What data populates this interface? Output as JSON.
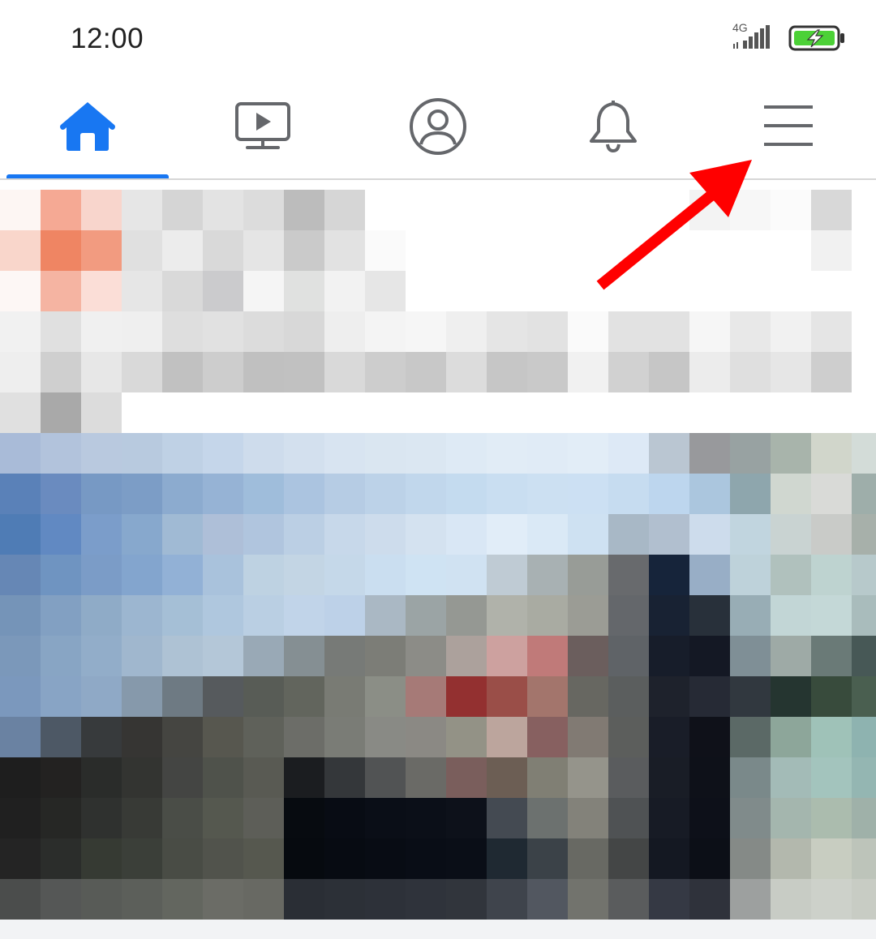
{
  "status_bar": {
    "time": "12:00",
    "network_type": "4G",
    "signal_icon": "signal-bars-icon",
    "battery_icon": "battery-charging-icon",
    "battery_color": "#4cd137"
  },
  "nav": {
    "accent_color": "#1877f2",
    "inactive_color": "#65676b",
    "active_tab": "home",
    "tabs": [
      {
        "id": "home",
        "icon": "home-icon"
      },
      {
        "id": "watch",
        "icon": "video-play-icon"
      },
      {
        "id": "profile",
        "icon": "profile-icon"
      },
      {
        "id": "notifications",
        "icon": "bell-icon"
      },
      {
        "id": "menu",
        "icon": "hamburger-menu-icon"
      }
    ]
  },
  "feed": {
    "content": "pixelated-post-image"
  },
  "annotation": {
    "type": "arrow",
    "color": "#ff0000",
    "points_to": "menu"
  }
}
